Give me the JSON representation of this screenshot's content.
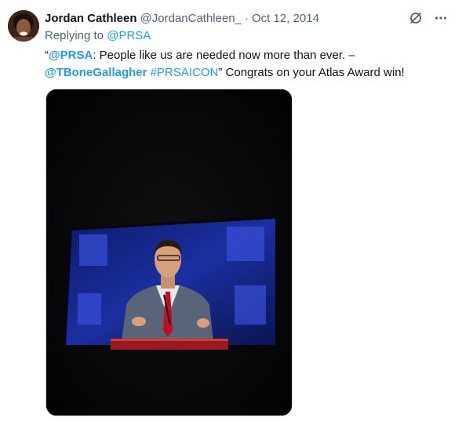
{
  "tweet": {
    "author_name": "Jordan Cathleen",
    "author_handle": "@JordanCathleen_",
    "separator": "·",
    "date": "Oct 12, 2014",
    "replying_to_prefix": "Replying to ",
    "replying_to_handle": "@PRSA",
    "text": {
      "open_quote": "“",
      "mention1": "@PRSA",
      "body1": ": People like us are needed now more than ever. –",
      "mention2": "@TBoneGallagher",
      "space": " ",
      "hashtag": "#PRSAICON",
      "body2": "” Congrats on your Atlas Award win!"
    },
    "media_icon": "speaker-photo",
    "more_icon": "more-icon",
    "grok_icon": "grok-icon"
  },
  "colors": {
    "accent": "#1d9bf0",
    "muted": "#536471",
    "text": "#0f1419"
  }
}
